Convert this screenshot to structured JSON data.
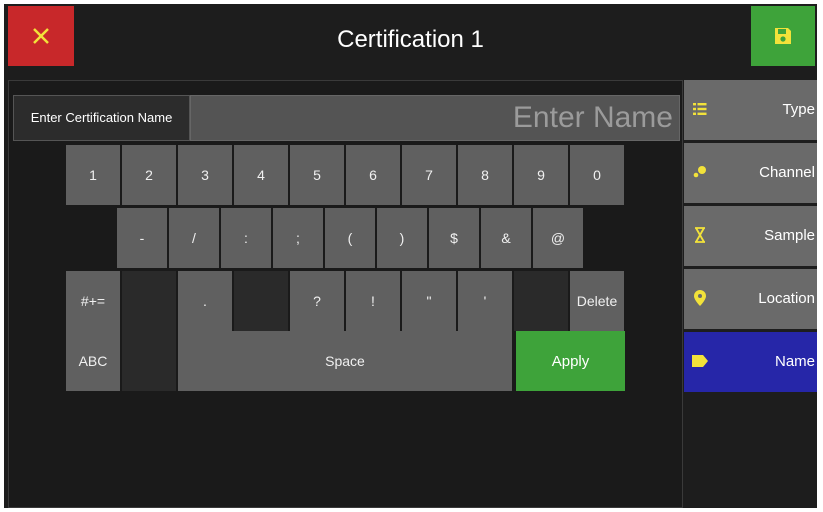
{
  "header": {
    "title": "Certification 1",
    "close_icon": "close-icon",
    "save_icon": "save-icon"
  },
  "name_field": {
    "label": "Enter Certification Name",
    "placeholder": "Enter Name"
  },
  "keyboard": {
    "row1": [
      "1",
      "2",
      "3",
      "4",
      "5",
      "6",
      "7",
      "8",
      "9",
      "0"
    ],
    "row2": [
      "-",
      "/",
      ":",
      ";",
      "(",
      ")",
      "$",
      "&",
      "@"
    ],
    "row3": [
      "#+=",
      "",
      ".",
      "",
      "?",
      "!",
      "\"",
      "'",
      "",
      "Delete"
    ],
    "row4": {
      "abc": "ABC",
      "space": "Space",
      "apply": "Apply"
    }
  },
  "sidebar": {
    "items": [
      {
        "label": "Type",
        "icon": "list-icon"
      },
      {
        "label": "Channel",
        "icon": "channel-icon"
      },
      {
        "label": "Sample",
        "icon": "hourglass-icon"
      },
      {
        "label": "Location",
        "icon": "location-pin-icon"
      },
      {
        "label": "Name",
        "icon": "tag-icon",
        "active": true
      }
    ]
  },
  "colors": {
    "close": "#c8282a",
    "save": "#3ea33a",
    "apply": "#3ea33a",
    "active_tab": "#2626a8",
    "icon_yellow": "#f2e23a"
  }
}
